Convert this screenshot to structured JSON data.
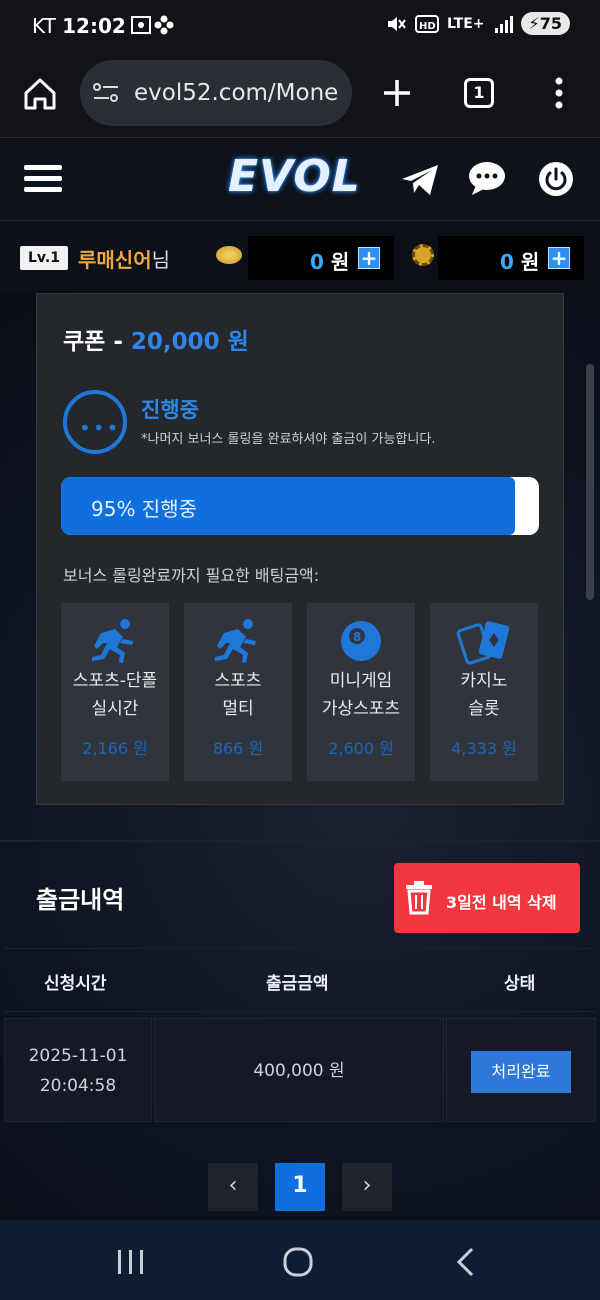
{
  "status_bar": {
    "carrier": "KT",
    "time": "12:02",
    "network": "LTE+",
    "battery": "75"
  },
  "browser": {
    "url": "evol52.com/Mone",
    "tab_count": "1"
  },
  "site": {
    "logo": "EVOL"
  },
  "user": {
    "level": "Lv.1",
    "name": "루매신어",
    "suffix": "님",
    "cash_value": "0",
    "cash_unit": "원",
    "point_value": "0",
    "point_unit": "원"
  },
  "coupon": {
    "title_prefix": "쿠폰 - ",
    "amount": "20,000 원",
    "status_title": "진행중",
    "status_note": "*나머지 보너스 롤링을 완료하셔야 출금이 가능합니다.",
    "progress_percent": 95,
    "progress_label": "95% 진행중",
    "required_label": "보너스 롤링완료까지 필요한 배팅금액:",
    "cards": [
      {
        "icon": "runner-icon",
        "name": "스포츠-단폴\n실시간",
        "amount": "2,166 원"
      },
      {
        "icon": "runner-icon",
        "name": "스포츠\n멀티",
        "amount": "866 원"
      },
      {
        "icon": "billiard-ball-icon",
        "name": "미니게임\n가상스포츠",
        "amount": "2,600 원"
      },
      {
        "icon": "playing-cards-icon",
        "name": "카지노\n슬롯",
        "amount": "4,333 원"
      }
    ]
  },
  "withdrawals": {
    "title": "출금내역",
    "delete_label": "3일전 내역 삭제",
    "columns": [
      "신청시간",
      "출금금액",
      "상태"
    ],
    "rows": [
      {
        "date": "2025-11-01",
        "time": "20:04:58",
        "amount": "400,000 원",
        "status": "처리완료"
      }
    ]
  },
  "pagination": {
    "prev": "‹",
    "current": "1",
    "next": "›"
  }
}
